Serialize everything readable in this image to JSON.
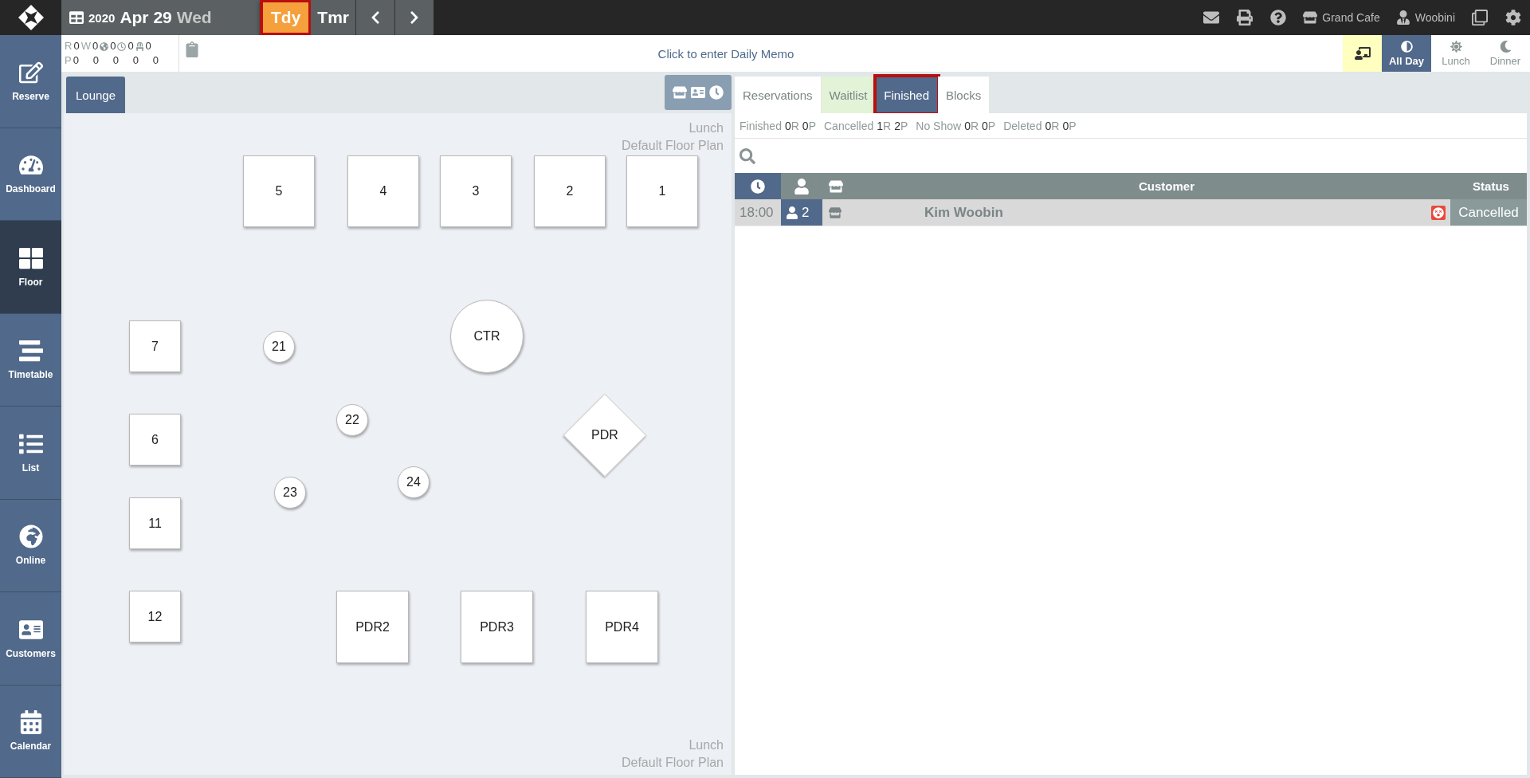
{
  "date": {
    "year": "2020",
    "month_day": "Apr 29",
    "weekday": "Wed"
  },
  "day_buttons": [
    {
      "label": "Tdy",
      "selected": true,
      "highlighted": true
    },
    {
      "label": "Tmr",
      "selected": false,
      "highlighted": false
    }
  ],
  "header_links": [
    {
      "kind": "venue",
      "label": "Grand Cafe"
    },
    {
      "kind": "user",
      "label": "Woobini"
    }
  ],
  "sidebar": {
    "items": [
      {
        "kind": "reserve",
        "label": "Reserve",
        "selected": false
      },
      {
        "kind": "dashboard",
        "label": "Dashboard",
        "selected": false
      },
      {
        "kind": "floor",
        "label": "Floor",
        "selected": true
      },
      {
        "kind": "timetable",
        "label": "Timetable",
        "selected": false
      },
      {
        "kind": "list",
        "label": "List",
        "selected": false
      },
      {
        "kind": "online",
        "label": "Online",
        "selected": false
      },
      {
        "kind": "customers",
        "label": "Customers",
        "selected": false
      },
      {
        "kind": "calendar",
        "label": "Calendar",
        "selected": false
      }
    ]
  },
  "counters": [
    {
      "cells": [
        {
          "kind": "label",
          "text": "R"
        },
        {
          "kind": "value",
          "text": "0"
        },
        {
          "kind": "label",
          "text": "W"
        },
        {
          "kind": "value",
          "text": "0"
        },
        {
          "kind": "globe"
        },
        {
          "kind": "value",
          "text": "0"
        },
        {
          "kind": "clock"
        },
        {
          "kind": "value",
          "text": "0"
        },
        {
          "kind": "chair"
        },
        {
          "kind": "value",
          "text": "0"
        }
      ]
    },
    {
      "cells": [
        {
          "kind": "label",
          "text": "P"
        },
        {
          "kind": "value",
          "text": "0"
        },
        {
          "kind": "value",
          "text": "0"
        },
        {
          "kind": "value",
          "text": "0"
        },
        {
          "kind": "value",
          "text": "0"
        },
        {
          "kind": "value",
          "text": "0"
        }
      ]
    }
  ],
  "memo": "Click to enter Daily Memo",
  "meal_periods": [
    {
      "kind": "allday",
      "label": "All Day",
      "selected": true
    },
    {
      "kind": "lunch",
      "label": "Lunch",
      "selected": false
    },
    {
      "kind": "dinner",
      "label": "Dinner",
      "selected": false
    }
  ],
  "floor": {
    "tabs": [
      {
        "label": "Lounge",
        "selected": true
      }
    ],
    "caption_top": [
      "Lunch",
      "Default Floor Plan"
    ],
    "caption_bottom": [
      "Lunch",
      "Default Floor Plan"
    ],
    "tables": [
      {
        "kind": "square",
        "label": "5"
      },
      {
        "kind": "square",
        "label": "4"
      },
      {
        "kind": "square",
        "label": "3"
      },
      {
        "kind": "square",
        "label": "2"
      },
      {
        "kind": "square",
        "label": "1"
      },
      {
        "kind": "square",
        "label": "7"
      },
      {
        "kind": "circle",
        "label": "21"
      },
      {
        "kind": "round",
        "label": "CTR"
      },
      {
        "kind": "circle",
        "label": "22"
      },
      {
        "kind": "diamond",
        "label": "PDR"
      },
      {
        "kind": "square",
        "label": "6"
      },
      {
        "kind": "circle",
        "label": "24"
      },
      {
        "kind": "circle",
        "label": "23"
      },
      {
        "kind": "square",
        "label": "11"
      },
      {
        "kind": "square",
        "label": "12"
      },
      {
        "kind": "square",
        "label": "PDR2"
      },
      {
        "kind": "square",
        "label": "PDR3"
      },
      {
        "kind": "square",
        "label": "PDR4"
      }
    ]
  },
  "bookings": {
    "tabs": [
      {
        "kind": "plain",
        "label": "Reservations",
        "selected": false,
        "highlighted": false
      },
      {
        "kind": "waitlist",
        "label": "Waitlist",
        "selected": false,
        "highlighted": false
      },
      {
        "kind": "plain",
        "label": "Finished",
        "selected": true,
        "highlighted": true
      },
      {
        "kind": "plain",
        "label": "Blocks",
        "selected": false,
        "highlighted": false
      }
    ],
    "stats": [
      {
        "label": "Finished",
        "reservations": "0",
        "r_unit": "R",
        "people": "0",
        "p_unit": "P"
      },
      {
        "label": "Cancelled",
        "reservations": "1",
        "r_unit": "R",
        "people": "2",
        "p_unit": "P"
      },
      {
        "label": "No Show",
        "reservations": "0",
        "r_unit": "R",
        "people": "0",
        "p_unit": "P"
      },
      {
        "label": "Deleted",
        "reservations": "0",
        "r_unit": "R",
        "people": "0",
        "p_unit": "P"
      }
    ],
    "columns": {
      "customer": "Customer",
      "status": "Status"
    },
    "rows": [
      {
        "time": "18:00",
        "party": "2",
        "customer": "Kim Woobin",
        "status": "Cancelled"
      }
    ]
  }
}
